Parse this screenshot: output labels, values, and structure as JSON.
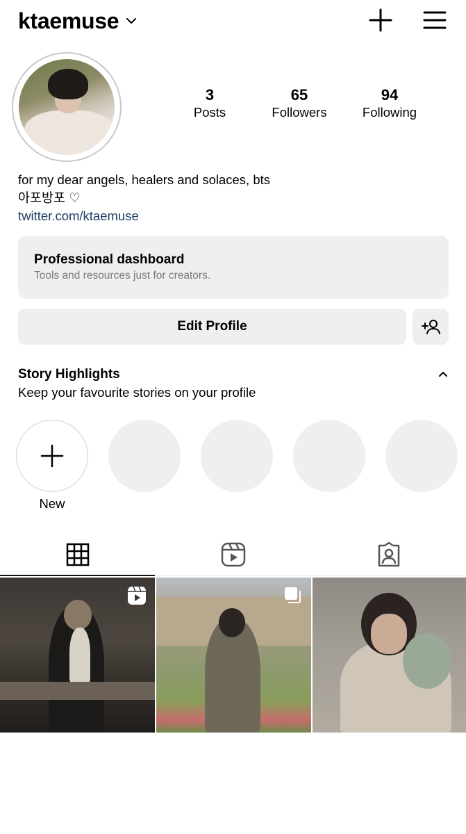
{
  "header": {
    "username": "ktaemuse"
  },
  "profile": {
    "stats": [
      {
        "value": "3",
        "label": "Posts"
      },
      {
        "value": "65",
        "label": "Followers"
      },
      {
        "value": "94",
        "label": "Following"
      }
    ],
    "bio_line1": "for my dear angels, healers and solaces, bts",
    "bio_line2": "아포방포 ♡",
    "link": "twitter.com/ktaemuse"
  },
  "dashboard": {
    "title": "Professional dashboard",
    "subtitle": "Tools and resources just for creators."
  },
  "actions": {
    "edit_profile": "Edit Profile"
  },
  "highlights": {
    "title": "Story Highlights",
    "subtitle": "Keep your favourite stories on your profile",
    "new_label": "New"
  },
  "tabs": {
    "active": "posts-grid",
    "items": [
      "grid-icon",
      "reels-icon",
      "tagged-icon"
    ]
  },
  "posts": [
    {
      "type": "reel"
    },
    {
      "type": "carousel"
    },
    {
      "type": "photo"
    }
  ]
}
